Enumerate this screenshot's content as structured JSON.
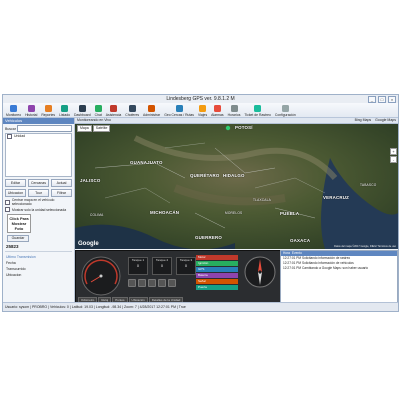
{
  "window": {
    "title": "Lindesberg GPS ver. 9.8.1.2 M",
    "controls": [
      "_",
      "□",
      "×"
    ]
  },
  "toolbar": {
    "items": [
      {
        "label": "Monitoreo",
        "color": "#3a7bd5"
      },
      {
        "label": "Historial",
        "color": "#8e44ad"
      },
      {
        "label": "Reportes",
        "color": "#e67e22"
      },
      {
        "label": "Listado",
        "color": "#16a085"
      },
      {
        "label": "Dashboard",
        "color": "#2c3e50"
      },
      {
        "label": "Chat",
        "color": "#27ae60"
      },
      {
        "label": "Asistencia",
        "color": "#c0392b"
      },
      {
        "label": "Choferes",
        "color": "#34495e"
      },
      {
        "label": "Administrar",
        "color": "#d35400"
      },
      {
        "label": "Geo Cercas / Rutas",
        "color": "#2980b9"
      },
      {
        "label": "Viajes",
        "color": "#f39c12"
      },
      {
        "label": "Alarmas",
        "color": "#e74c3c"
      },
      {
        "label": "Horarios",
        "color": "#7f8c8d"
      },
      {
        "label": "Ticket de Rastreo",
        "color": "#1abc9c"
      },
      {
        "label": "Configuración",
        "color": "#95a5a6"
      }
    ]
  },
  "left": {
    "header": "Vehiculos",
    "search_label": "Buscar",
    "search_value": "",
    "list_items": [
      "Unidad"
    ],
    "buttons_row1": [
      "Editar",
      "Cercanas",
      "Actual"
    ],
    "buttons_row2": [
      "Ubicacion",
      "Tour",
      "Filtrar"
    ],
    "check1": "Centrar mapa en el vehículo seleccionado",
    "check2": "Mostrar solo la unidad seleccionada",
    "clickbox": [
      "Click Para",
      "Mostrar",
      "Foto"
    ],
    "clickbox_btn": "Guardar",
    "unit_id": "25823",
    "sections_title": "Ultimo Transmision",
    "links": [
      "Fecha",
      "Transcurrido",
      "Ubicacion"
    ]
  },
  "map": {
    "header": "Monitoreando en Vivo",
    "tabs": [
      "Mapa",
      "Satélite"
    ],
    "links": [
      "Bing Maps",
      "Google Maps"
    ],
    "labels": [
      {
        "text": "POTOSÍ",
        "cls": ""
      },
      {
        "text": "GUANAJUATO",
        "cls": ""
      },
      {
        "text": "QUERÉTARO",
        "cls": ""
      },
      {
        "text": "HIDALGO",
        "cls": ""
      },
      {
        "text": "MICHOACÁN",
        "cls": ""
      },
      {
        "text": "VERACRUZ",
        "cls": ""
      },
      {
        "text": "GUERRERO",
        "cls": ""
      },
      {
        "text": "TLAXCALA",
        "cls": "sm"
      },
      {
        "text": "PUEBLA",
        "cls": ""
      },
      {
        "text": "MORELOS",
        "cls": "sm"
      },
      {
        "text": "OAXACA",
        "cls": ""
      },
      {
        "text": "TABASCO",
        "cls": "sm"
      },
      {
        "text": "JALISCO",
        "cls": ""
      },
      {
        "text": "COLIMA",
        "cls": "sm"
      }
    ],
    "zoom": [
      "+",
      "-"
    ],
    "google": "Google",
    "attribution": "Datos del mapa ©2017 Google, INEGI  Términos de uso"
  },
  "dashboard": {
    "tanks": [
      {
        "label": "Tanque 1",
        "value": "0"
      },
      {
        "label": "Tanque 2",
        "value": "0"
      },
      {
        "label": "Tanque 3",
        "value": "0"
      }
    ],
    "status": [
      {
        "label": "Motor",
        "color": "#c0392b"
      },
      {
        "label": "Ignición",
        "color": "#27ae60"
      },
      {
        "label": "GPS",
        "color": "#2980b9"
      },
      {
        "label": "Batería",
        "color": "#8e44ad"
      },
      {
        "label": "Señal",
        "color": "#d35400"
      },
      {
        "label": "Puerta",
        "color": "#16a085"
      }
    ],
    "labels": [
      "Odómetro",
      "Reloj",
      "Puntos",
      "Ubicación",
      "Detalles de la Unidad"
    ]
  },
  "events": {
    "headers": [
      "Hora",
      "Evento"
    ],
    "rows": [
      "12:27:01 PM  Solicitando información de rastreo",
      "12:27:01 PM  Solicitando información de vehículos",
      "12:27:01 PM  Cambiando a Google Maps: son haber usuario"
    ]
  },
  "statusbar": "Usuario: sysom | PROBRO | Vehiculos: 0 | Latitud: 19.03  | Longitud: -98.34 | Zoom: 7 | 4/28/2017 12:27:01 PM | True"
}
